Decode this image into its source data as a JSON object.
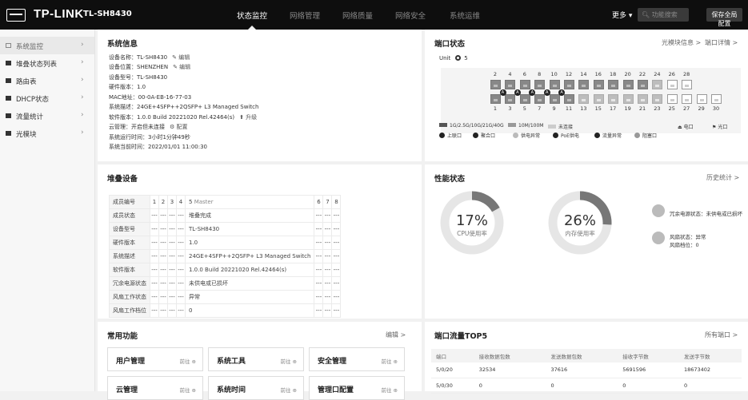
{
  "topbar": {
    "brand": "TP-LINK",
    "model": "TL-SH8430",
    "nav": [
      {
        "label": "状态监控",
        "active": true
      },
      {
        "label": "网络管理",
        "active": false
      },
      {
        "label": "网络质量",
        "active": false
      },
      {
        "label": "网络安全",
        "active": false
      },
      {
        "label": "系统运维",
        "active": false
      }
    ],
    "more": "更多 ▾",
    "search_placeholder": "功能搜索",
    "save": "保存全局配置"
  },
  "sidebar": {
    "items": [
      {
        "label": "系统监控",
        "icon": "monitor-icon",
        "active": true
      },
      {
        "label": "堆叠状态列表",
        "icon": "list-icon",
        "active": false
      },
      {
        "label": "路由表",
        "icon": "route-icon",
        "active": false
      },
      {
        "label": "DHCP状态",
        "icon": "dhcp-icon",
        "active": false
      },
      {
        "label": "流量统计",
        "icon": "traffic-icon",
        "active": false
      },
      {
        "label": "光模块",
        "icon": "module-icon",
        "active": false
      }
    ]
  },
  "sysinfo": {
    "title": "系统信息",
    "rows": [
      {
        "text": "设备名称：TL-SH8430",
        "action": "✎ 编辑"
      },
      {
        "text": "设备位置：SHENZHEN",
        "action": "✎ 编辑"
      },
      {
        "text": "设备型号：TL-SH8430",
        "action": ""
      },
      {
        "text": "硬件版本：1.0",
        "action": ""
      },
      {
        "text": "MAC地址：00-0A-EB-16-77-03",
        "action": ""
      },
      {
        "text": "系统描述：24GE+4SFP++2QSFP+ L3 Managed Switch",
        "action": ""
      },
      {
        "text": "软件版本：1.0.0 Build 20221020 Rel.42464(s)",
        "action": "⬆ 升级"
      },
      {
        "text": "云管理：开启但未连接",
        "action": "⚙ 配置"
      },
      {
        "text": "系统运行时间：3小时1分钟49秒",
        "action": ""
      },
      {
        "text": "系统当前时间：2022/01/01 11:00:30",
        "action": ""
      }
    ]
  },
  "portstatus": {
    "title": "端口状态",
    "link1": "光模块信息 >",
    "link2": "端口详情 >",
    "unit_label": "Unit",
    "unit_value": "5",
    "top_numbers": [
      "2",
      "4",
      "6",
      "8",
      "10",
      "12",
      "14",
      "16",
      "18",
      "20",
      "22",
      "24",
      "26",
      "28"
    ],
    "bottom_numbers": [
      "1",
      "3",
      "5",
      "7",
      "9",
      "11",
      "13",
      "15",
      "17",
      "19",
      "21",
      "23",
      "25",
      "27",
      "29",
      "30"
    ],
    "legend": [
      {
        "label": "1G/2.5G/10G/21G/40G",
        "color": "#555555"
      },
      {
        "label": "10M/100M",
        "color": "#999999"
      },
      {
        "label": "未连接",
        "color": "#cccccc"
      }
    ],
    "legend_icons": [
      {
        "label": "上联口",
        "icon": "uplink-icon"
      },
      {
        "label": "聚合口",
        "icon": "aggregate-icon"
      },
      {
        "label": "供电异常",
        "icon": "power-error-icon"
      },
      {
        "label": "PoE供电",
        "icon": "poe-icon"
      },
      {
        "label": "流量异常",
        "icon": "traffic-error-icon"
      },
      {
        "label": "阻塞口",
        "icon": "blocked-icon"
      }
    ],
    "elec_label": "电口",
    "optical_label": "光口"
  },
  "stack": {
    "title": "堆叠设备",
    "header": [
      "成员编号",
      "1",
      "2",
      "3",
      "4",
      "5",
      "Master",
      "6",
      "7",
      "8"
    ],
    "rows": [
      {
        "label": "成员状态",
        "value": "堆叠完成"
      },
      {
        "label": "设备型号",
        "value": "TL-SH8430"
      },
      {
        "label": "硬件版本",
        "value": "1.0"
      },
      {
        "label": "系统描述",
        "value": "24GE+4SFP++2QSFP+ L3 Managed Switch"
      },
      {
        "label": "软件版本",
        "value": "1.0.0 Build 20221020 Rel.42464(s)"
      },
      {
        "label": "冗余电源状态",
        "value": "未供电或已损坏"
      },
      {
        "label": "风扇工作状态",
        "value": "异常"
      },
      {
        "label": "风扇工作档位",
        "value": "0"
      }
    ],
    "dash": "---"
  },
  "performance": {
    "title": "性能状态",
    "link": "历史统计 >",
    "cpu": {
      "value": "17%",
      "label": "CPU使用率",
      "fraction": 0.17
    },
    "mem": {
      "value": "26%",
      "label": "内存使用率",
      "fraction": 0.26
    },
    "power_status": "冗余电源状态：未供电或已损坏",
    "fan_status": "风扇状态：异常",
    "fan_level": "风扇档位：0"
  },
  "common": {
    "title": "常用功能",
    "edit": "编辑 >",
    "goto": "前往 ⊕",
    "cards": [
      "用户管理",
      "系统工具",
      "安全管理",
      "云管理",
      "系统时间",
      "管理口配置"
    ]
  },
  "top5": {
    "title": "端口流量TOP5",
    "link": "所有端口 >",
    "columns": [
      "端口",
      "接收数据包数",
      "发送数据包数",
      "接收字节数",
      "发送字节数"
    ],
    "rows": [
      [
        "5/0/20",
        "32534",
        "37616",
        "5691596",
        "18673402"
      ],
      [
        "5/0/30",
        "0",
        "0",
        "0",
        "0"
      ]
    ]
  },
  "colors": {
    "topbar": "#0e0e0e",
    "gauge_fill": "#777777",
    "gauge_track": "#e6e6e6"
  }
}
